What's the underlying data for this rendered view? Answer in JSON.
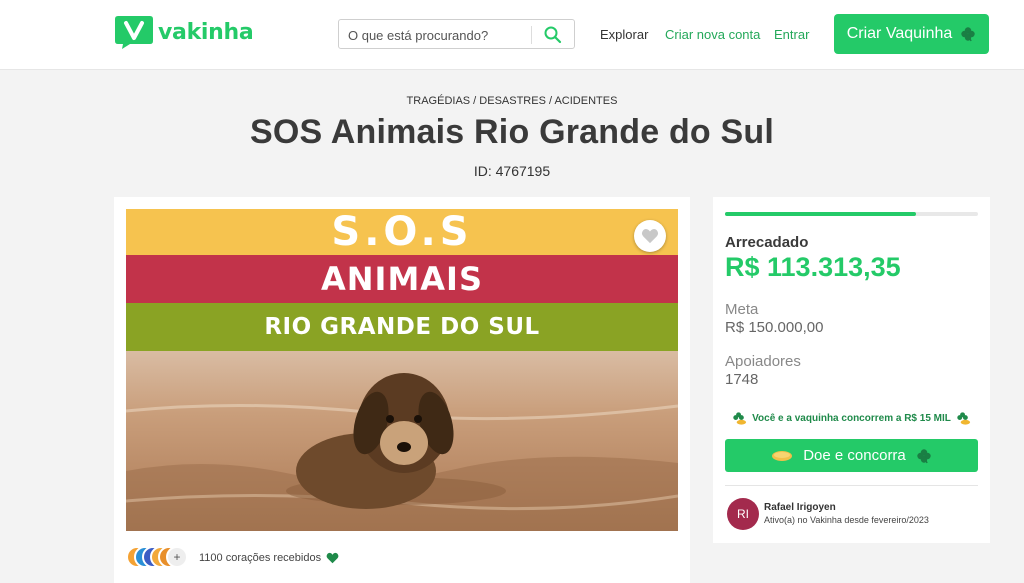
{
  "header": {
    "logo_text": "vakinha",
    "search_placeholder": "O que está procurando?",
    "nav_explorar": "Explorar",
    "nav_criar_conta": "Criar nova conta",
    "nav_entrar": "Entrar",
    "cta_label": "Criar Vaquinha"
  },
  "campaign": {
    "breadcrumb": "TRAGÉDIAS / DESASTRES / ACIDENTES",
    "title": "SOS Animais Rio Grande do Sul",
    "id_text": "ID: 4767195",
    "image": {
      "line1": "S.O.S",
      "line2": "ANIMAIS",
      "line3": "RIO GRANDE DO SUL"
    },
    "supporters_plus": "+",
    "hearts_text": "1100 corações recebidos"
  },
  "stats": {
    "progress_fraction": 0.755,
    "arrecadado_label": "Arrecadado",
    "arrecadado_value": "R$ 113.313,35",
    "meta_label": "Meta",
    "meta_value": "R$ 150.000,00",
    "apoiadores_label": "Apoiadores",
    "apoiadores_value": "1748",
    "promo_text": "Você e a vaquinha concorrem a R$ 15 MIL",
    "donate_label": "Doe e concorra"
  },
  "owner": {
    "initials": "RI",
    "name": "Rafael Irigoyen",
    "since": "Ativo(a) no Vakinha desde fevereiro/2023"
  },
  "colors": {
    "brand_green": "#24ca68",
    "band_yellow": "#f6c34f",
    "band_red": "#c2334a",
    "band_olive": "#8aa324",
    "owner_avatar": "#a32a4d"
  },
  "icons": [
    "vakinha-logo-icon",
    "search-icon",
    "clover-icon",
    "heart-icon",
    "coin-icon"
  ]
}
